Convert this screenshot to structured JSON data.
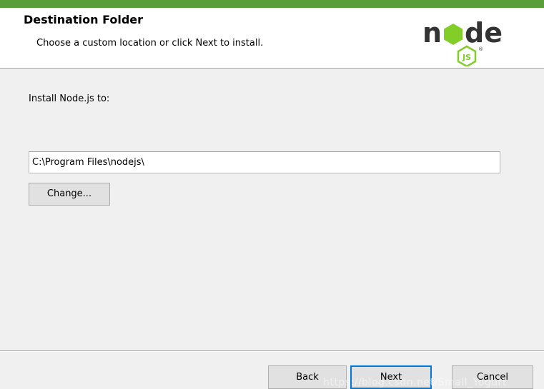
{
  "header": {
    "title": "Destination Folder",
    "subtitle": "Choose a custom location or click Next to install.",
    "logo": {
      "word_left": "n",
      "word_right": "de",
      "hex_label": "JS",
      "mark": "®"
    }
  },
  "main": {
    "install_label": "Install Node.js to:",
    "path_value": "C:\\Program Files\\nodejs\\",
    "change_label": "Change..."
  },
  "footer": {
    "back_label": "Back",
    "next_label": "Next",
    "cancel_label": "Cancel"
  },
  "watermark": "https://blog.csdn.net/Small_Yogurt",
  "colors": {
    "accent": "#5a9e3a",
    "logo_dark": "#333333",
    "logo_green": "#83cd29",
    "focus_border": "#0078d7"
  }
}
